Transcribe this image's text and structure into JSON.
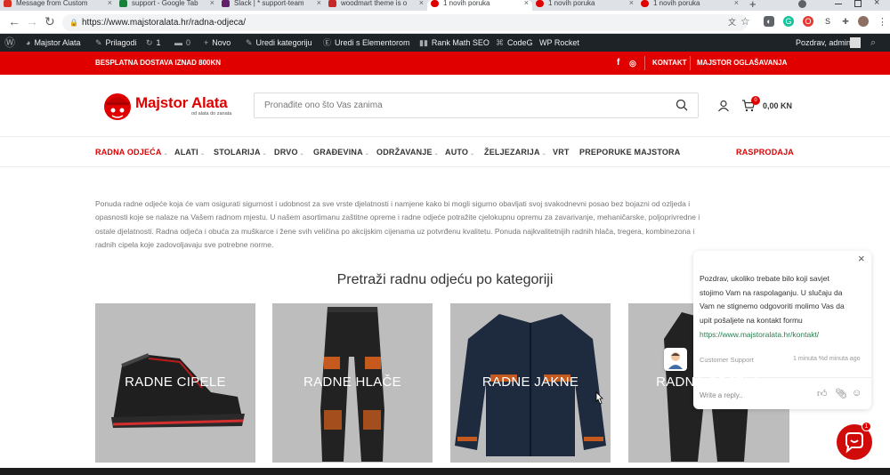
{
  "browser": {
    "tabs": [
      {
        "label": "Message from Custom",
        "fav_color": "#d93025"
      },
      {
        "label": "support - Google Tab",
        "fav_color": "#188038"
      },
      {
        "label": "Slack | * support-team",
        "fav_color": "#611f69"
      },
      {
        "label": "woodmart theme is o",
        "fav_color": "#c62828"
      },
      {
        "label": "1 novih poruka",
        "fav_color": "#e00000"
      },
      {
        "label": "1 novih poruka",
        "fav_color": "#e00000"
      },
      {
        "label": "1 novih poruka",
        "fav_color": "#e00000"
      }
    ],
    "new_tab": "+",
    "url": "https://www.majstoralata.hr/radna-odjeca/"
  },
  "wp_admin": {
    "items": [
      "Majstor Alata",
      "Prilagodi",
      "1",
      "0",
      "Novo",
      "Uredi kategoriju",
      "Uredi s Elementorom",
      "Rank Math SEO",
      "CodeG",
      "WP Rocket"
    ],
    "greeting": "Pozdrav, admin"
  },
  "topbar": {
    "shipping": "BESPLATNA DOSTAVA IZNAD 800KN",
    "links": [
      "KONTAKT",
      "MAJSTOR OGLAŠAVANJA"
    ],
    "social": [
      "f",
      "◎"
    ]
  },
  "header": {
    "logo_title": "Majstor Alata",
    "logo_sub": "od alata do zanata",
    "search_placeholder": "Pronađite ono što Vas zanima",
    "cart_count": "0",
    "cart_total": "0,00 KN"
  },
  "nav": {
    "items": [
      {
        "label": "RADNA ODJEĆA",
        "dd": true
      },
      {
        "label": "ALATI",
        "dd": true
      },
      {
        "label": "STOLARIJA",
        "dd": true
      },
      {
        "label": "DRVO",
        "dd": true
      },
      {
        "label": "GRAĐEVINA",
        "dd": true
      },
      {
        "label": "ODRŽAVANJE",
        "dd": true
      },
      {
        "label": "AUTO",
        "dd": true
      },
      {
        "label": "ŽELJEZARIJA",
        "dd": true
      },
      {
        "label": "VRT",
        "dd": false
      },
      {
        "label": "PREPORUKE MAJSTORA",
        "dd": false
      }
    ],
    "sale": "RASPRODAJA"
  },
  "content": {
    "intro_lines": [
      "Ponuda radne odjeće koja će vam osigurati sigurnost i udobnost za sve vrste djelatnosti i namjene kako bi mogli sigurno obavljati svoj svakodnevni posao bez bojazni od ozljeda i",
      "opasnosti koje se nalaze na Vašem radnom mjestu. U našem asortimanu zaštitne opreme i radne odjeće potražite cjelokupnu opremu za zavarivanje, mehaničarske, poljoprivredne i",
      "ostale djelatnosti. Radna odjeća i obuća za muškarce i žene svih veličina po akcijskim cijenama uz potvrđenu kvalitetu. Ponuda najkvalitetnijih radnih hlača, tregera, kombinezona i",
      "radnih cipela koje zadovoljavaju sve potrebne norme."
    ],
    "categories_title": "Pretraži radnu odjeću po kategoriji",
    "categories": [
      "RADNE CIPELE",
      "RADNE HLAČE",
      "RADNE JAKNE",
      "RADNA ODJELA"
    ]
  },
  "chat": {
    "close": "×",
    "message_lines": [
      "Pozdrav, ukoliko trebate bilo koji savjet",
      "stojimo Vam na raspolaganju. U slučaju da",
      "Vam ne stignemo odgovoriti molimo Vas da",
      "upit pošaljete na kontakt formu"
    ],
    "link": "https://www.majstoralata.hr/kontakt/",
    "agent": "Customer Support",
    "time": "1 minuta %d minuta ago",
    "reply_placeholder": "Write a reply..",
    "badge": "1"
  },
  "colors": {
    "brand_red": "#e00000",
    "wp_bar": "#1d2327",
    "link_green": "#2a7d4f"
  }
}
